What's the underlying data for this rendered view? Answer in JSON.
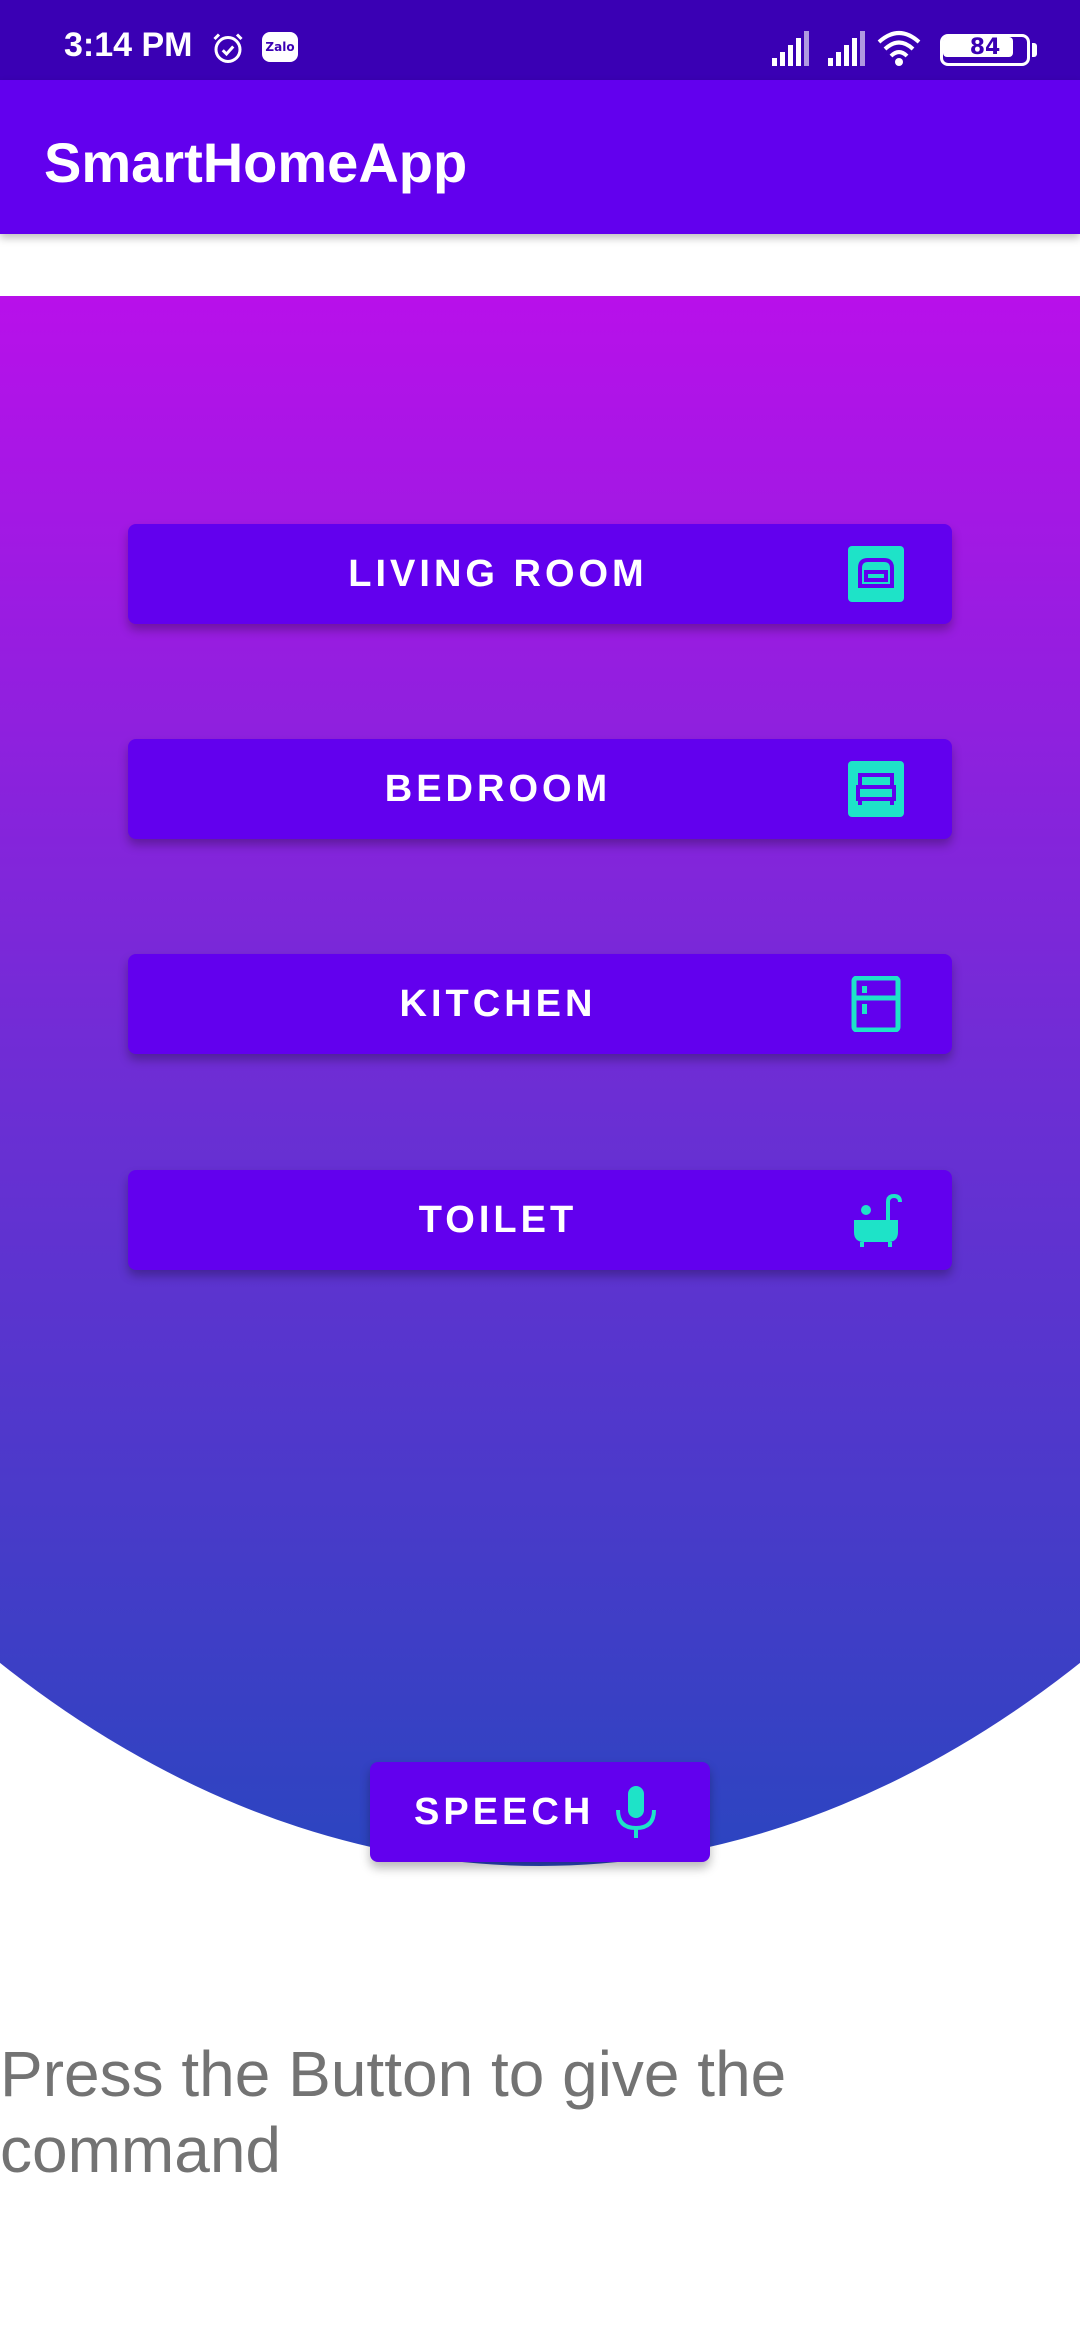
{
  "status_bar": {
    "time": "3:14 PM",
    "zalo_label": "Zalo",
    "battery_level": "84",
    "icons": [
      "alarm-icon",
      "zalo-icon",
      "signal-icon",
      "signal-icon",
      "wifi-icon",
      "battery-icon"
    ]
  },
  "app_bar": {
    "title": "SmartHomeApp"
  },
  "rooms": [
    {
      "label": "LIVING ROOM",
      "icon": "sofa-icon"
    },
    {
      "label": "BEDROOM",
      "icon": "bed-icon"
    },
    {
      "label": "KITCHEN",
      "icon": "fridge-icon"
    },
    {
      "label": "TOILET",
      "icon": "bathtub-icon"
    }
  ],
  "speech": {
    "label": "SPEECH",
    "icon": "microphone-icon"
  },
  "prompt": "Press the Button to give the command",
  "colors": {
    "status_bar": "#3a00b4",
    "primary": "#6200ee",
    "icon_accent": "#1ee3c8",
    "gradient_top": "#b810ea",
    "gradient_bottom": "#2b45c0",
    "prompt_text": "#737373"
  }
}
